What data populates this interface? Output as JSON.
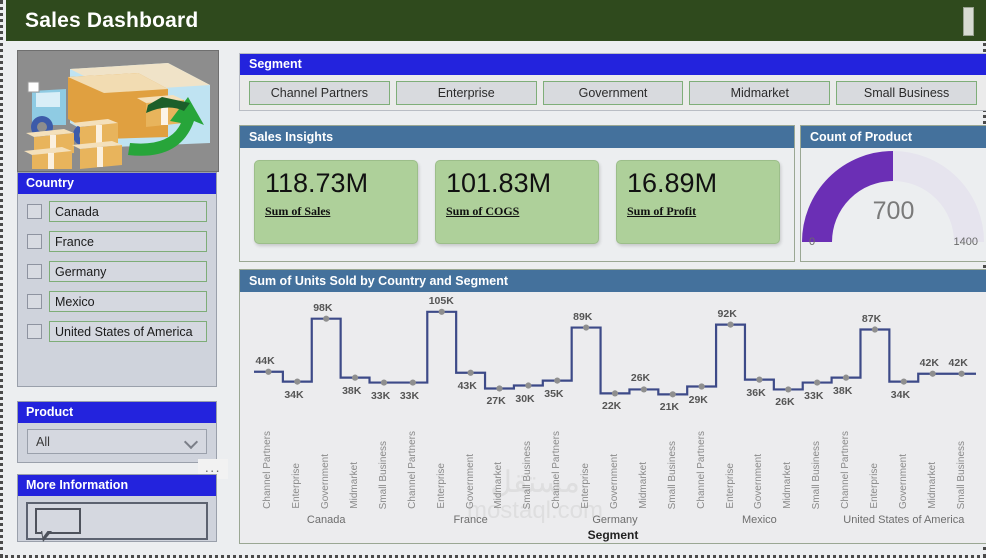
{
  "header": {
    "title": "Sales Dashboard"
  },
  "artwork": {
    "name": "delivery-truck-illustration"
  },
  "segment_slicer": {
    "title": "Segment",
    "options": [
      "Channel Partners",
      "Enterprise",
      "Government",
      "Midmarket",
      "Small Business"
    ]
  },
  "country_slicer": {
    "title": "Country",
    "items": [
      {
        "label": "Canada",
        "checked": false
      },
      {
        "label": "France",
        "checked": false
      },
      {
        "label": "Germany",
        "checked": false
      },
      {
        "label": "Mexico",
        "checked": false
      },
      {
        "label": "United States of America",
        "checked": false
      }
    ]
  },
  "product_slicer": {
    "title": "Product",
    "selected": "All",
    "more_options": "..."
  },
  "more_information": {
    "title": "More Information",
    "note": ""
  },
  "sales_insights": {
    "title": "Sales Insights",
    "cards": [
      {
        "value": "118.73M",
        "label": "Sum of Sales"
      },
      {
        "value": "101.83M",
        "label": "Sum of COGS"
      },
      {
        "value": "16.89M",
        "label": "Sum of Profit"
      }
    ]
  },
  "gauge": {
    "title": "Count of Product",
    "value": "700",
    "min": "0",
    "max": "1400",
    "percent": 50,
    "fill_color": "#6B2FB5",
    "track_color": "#e6e4ee"
  },
  "chart_data": {
    "type": "line",
    "title": "Sum of Units Sold by Country and Segment",
    "xlabel": "Segment",
    "ylabel": "",
    "grid": false,
    "legend": "none",
    "line_color": "#3d4a88",
    "marker_color": "#8f8f8f",
    "groups": [
      "Canada",
      "France",
      "Germany",
      "Mexico",
      "United States of America"
    ],
    "segments": [
      "Channel Partners",
      "Enterprise",
      "Government",
      "Midmarket",
      "Small Business"
    ],
    "categories": [
      "Canada / Channel Partners",
      "Canada / Enterprise",
      "Canada / Government",
      "Canada / Midmarket",
      "Canada / Small Business",
      "France / Channel Partners",
      "France / Enterprise",
      "France / Government",
      "France / Midmarket",
      "France / Small Business",
      "Germany / Channel Partners",
      "Germany / Enterprise",
      "Germany / Government",
      "Germany / Midmarket",
      "Germany / Small Business",
      "Mexico / Channel Partners",
      "Mexico / Enterprise",
      "Mexico / Government",
      "Mexico / Midmarket",
      "Mexico / Small Business",
      "USA / Channel Partners",
      "USA / Enterprise",
      "USA / Government",
      "USA / Midmarket",
      "USA / Small Business"
    ],
    "values": [
      44,
      34,
      98,
      38,
      33,
      33,
      105,
      43,
      27,
      30,
      35,
      89,
      22,
      26,
      21,
      29,
      92,
      36,
      26,
      33,
      38,
      87,
      34,
      42,
      42
    ],
    "value_labels": [
      "44K",
      "34K",
      "98K",
      "38K",
      "33K",
      "33K",
      "105K",
      "43K",
      "27K",
      "30K",
      "35K",
      "89K",
      "22K",
      "26K",
      "21K",
      "29K",
      "92K",
      "36K",
      "26K",
      "33K",
      "38K",
      "87K",
      "34K",
      "42K",
      "42K"
    ],
    "unit": "K",
    "ylim": [
      0,
      115
    ]
  },
  "watermark": {
    "arabic": "مستقل",
    "latin": "mostaql.com"
  }
}
